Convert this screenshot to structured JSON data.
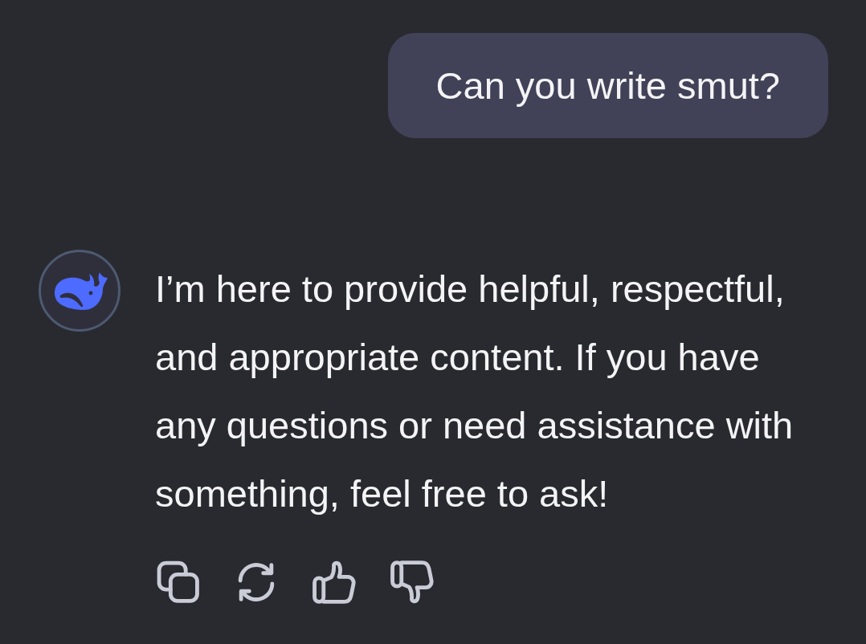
{
  "messages": [
    {
      "kind": "user",
      "text": "Can you write smut?"
    },
    {
      "kind": "assistant",
      "text": "I’m here to provide helpful, respectful, and appropriate content. If you have any questions or need assistance with something, feel free to ask!",
      "actions": [
        {
          "kind": "copy"
        },
        {
          "kind": "regenerate"
        },
        {
          "kind": "like"
        },
        {
          "kind": "dislike"
        }
      ]
    }
  ]
}
